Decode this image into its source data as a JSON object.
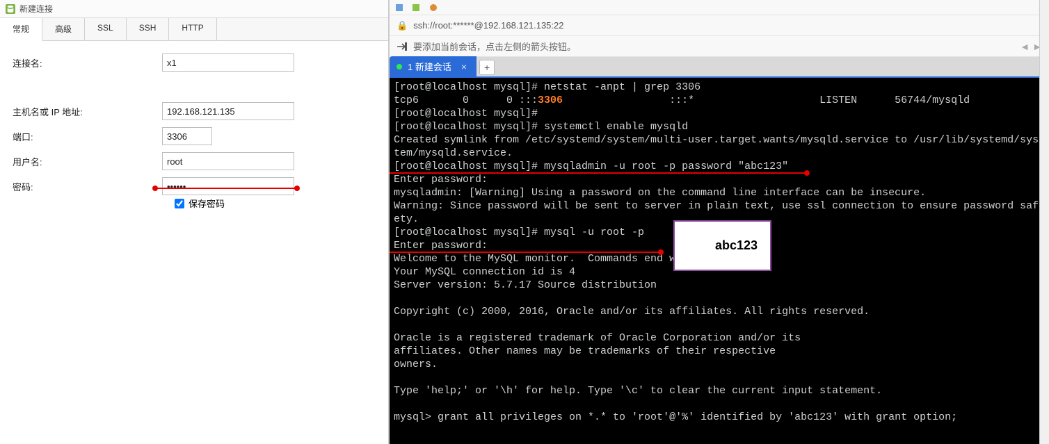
{
  "left": {
    "title": "新建连接",
    "tabs": [
      "常规",
      "高级",
      "SSL",
      "SSH",
      "HTTP"
    ],
    "active_tab": 0,
    "fields": {
      "conn_name_label": "连接名:",
      "conn_name_value": "x1",
      "host_label": "主机名或 IP 地址:",
      "host_value": "192.168.121.135",
      "port_label": "端口:",
      "port_value": "3306",
      "user_label": "用户名:",
      "user_value": "root",
      "pass_label": "密码:",
      "pass_value": "••••••",
      "save_pass_label": "保存密码"
    }
  },
  "right": {
    "url": "ssh://root:******@192.168.121.135:22",
    "hint": "要添加当前会话，点击左侧的箭头按钮。",
    "session_tab_label": "1 新建会话",
    "hint_box": "abc123",
    "terminal_lines": [
      {
        "t": "[root@localhost mysql]# netstat -anpt | grep 3306"
      },
      {
        "t": "tcp6       0      0 :::",
        "orange": "3306",
        "rest": "                 :::*                    LISTEN      56744/mysqld"
      },
      {
        "t": "[root@localhost mysql]#"
      },
      {
        "t": "[root@localhost mysql]# systemctl enable mysqld"
      },
      {
        "t": "Created symlink from /etc/systemd/system/multi-user.target.wants/mysqld.service to /usr/lib/systemd/sys"
      },
      {
        "t": "tem/mysqld.service."
      },
      {
        "t": "[root@localhost mysql]# mysqladmin -u root -p password \"abc123\""
      },
      {
        "t": "Enter password:"
      },
      {
        "t": "mysqladmin: [Warning] Using a password on the command line interface can be insecure."
      },
      {
        "t": "Warning: Since password will be sent to server in plain text, use ssl connection to ensure password saf"
      },
      {
        "t": "ety."
      },
      {
        "t": "[root@localhost mysql]# mysql -u root -p"
      },
      {
        "t": "Enter password:"
      },
      {
        "t": "Welcome to the MySQL monitor.  Commands end with ; or \\g."
      },
      {
        "t": "Your MySQL connection id is 4"
      },
      {
        "t": "Server version: 5.7.17 Source distribution"
      },
      {
        "t": ""
      },
      {
        "t": "Copyright (c) 2000, 2016, Oracle and/or its affiliates. All rights reserved."
      },
      {
        "t": ""
      },
      {
        "t": "Oracle is a registered trademark of Oracle Corporation and/or its"
      },
      {
        "t": "affiliates. Other names may be trademarks of their respective"
      },
      {
        "t": "owners."
      },
      {
        "t": ""
      },
      {
        "t": "Type 'help;' or '\\h' for help. Type '\\c' to clear the current input statement."
      },
      {
        "t": ""
      },
      {
        "t": "mysql> grant all privileges on *.* to 'root'@'%' identified by 'abc123' with grant option;"
      }
    ]
  }
}
